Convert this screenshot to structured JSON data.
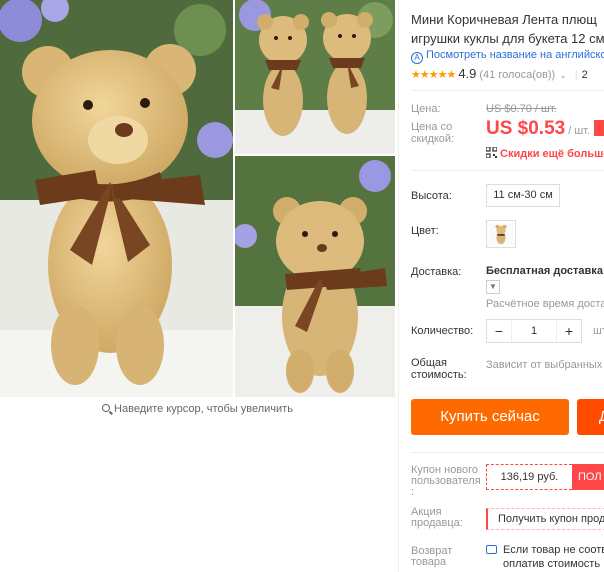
{
  "gallery": {
    "zoom_hint": "Наведите курсор, чтобы увеличить"
  },
  "product": {
    "title_line1": "Мини Коричневая Лента плющ",
    "title_line2": "игрушки куклы для букета 12 см",
    "translate_link": "Посмотреть название на английском",
    "rating_value": "4.9",
    "votes": "(41 голоса(ов))",
    "orders_fragment": "2"
  },
  "price": {
    "label": "Цена:",
    "old": "US $0.70 / шт.",
    "discount_label_line1": "Цена со",
    "discount_label_line2": "скидкой:",
    "value": "US $0.53",
    "unit": "/ шт.",
    "discount_text": "Скидки ещё больше"
  },
  "options": {
    "height_label": "Высота:",
    "height_value": "11 см-30 см",
    "color_label": "Цвет:"
  },
  "shipping": {
    "label": "Доставка:",
    "value": "Бесплатная доставка в",
    "time": "Расчётное время доставки"
  },
  "quantity": {
    "label": "Количество:",
    "value": "1",
    "minus": "−",
    "plus": "+",
    "unit": "шт. ("
  },
  "total": {
    "label_line1": "Общая",
    "label_line2": "стоимость:",
    "value": "Зависит от выбранных"
  },
  "actions": {
    "buy_now": "Купить сейчас",
    "add_to_cart": "Д"
  },
  "coupon": {
    "label_line1": "Купон нового",
    "label_line2": "пользователя",
    "label_line3": ":",
    "value": "136,19 руб.",
    "button": "ПОЛ"
  },
  "seller": {
    "label_line1": "Акция",
    "label_line2": "продавца:",
    "value": "Получить купон прода"
  },
  "returns": {
    "label_line1": "Возврат",
    "label_line2": "товара",
    "text_line1": "Если товар не соотв",
    "text_line2": "оплатив стоимость"
  },
  "colors": {
    "price_red": "#ff4747",
    "buy_orange": "#ff6a00",
    "link_blue": "#2a6fd6",
    "star_orange": "#ff9a00"
  }
}
